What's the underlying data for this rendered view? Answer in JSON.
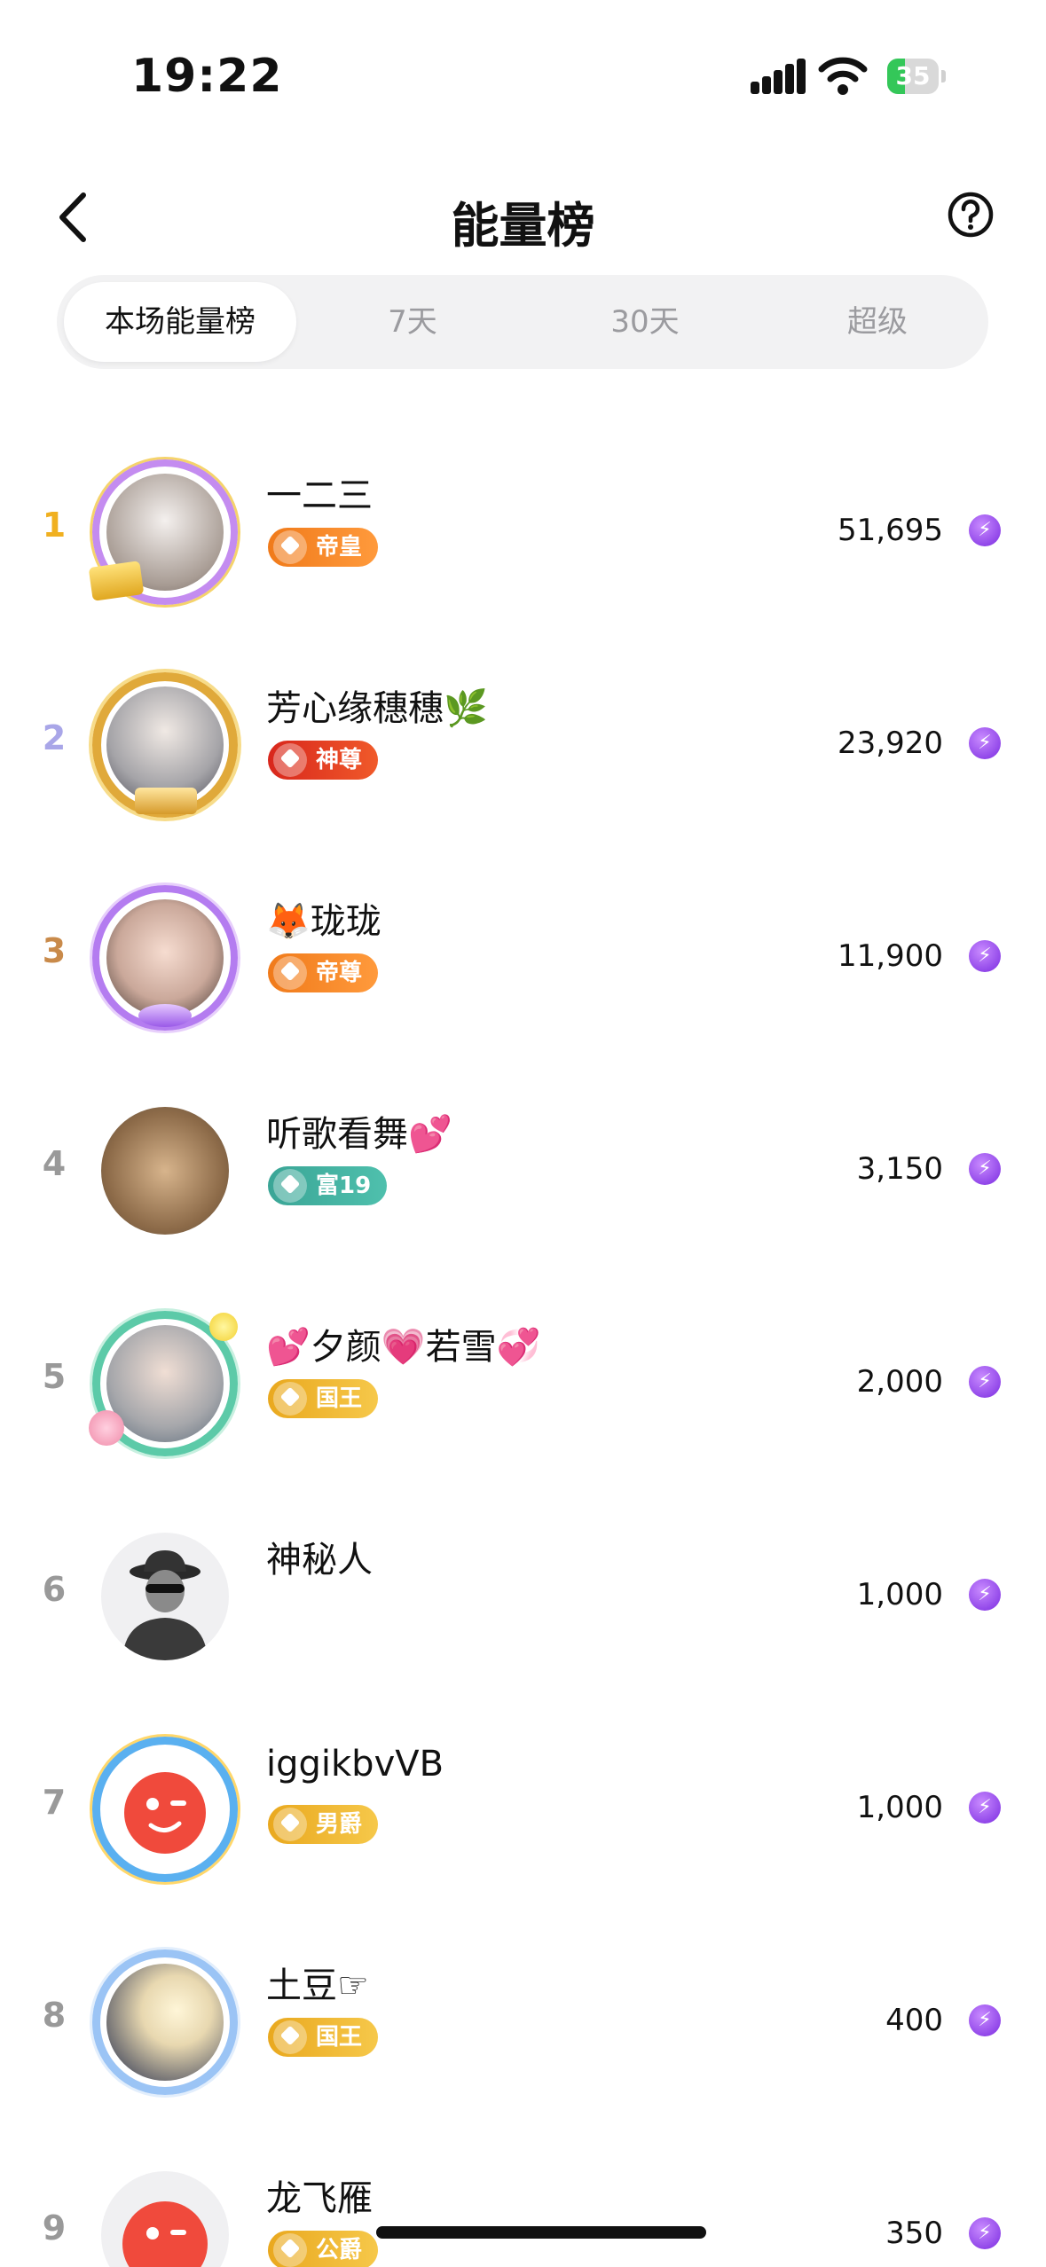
{
  "status_bar": {
    "time": "19:22",
    "battery": "35"
  },
  "header": {
    "title": "能量榜",
    "back_icon": "chevron-left-icon",
    "help_icon": "question-circle-icon"
  },
  "tabs": [
    {
      "label": "本场能量榜",
      "active": true
    },
    {
      "label": "7天",
      "active": false
    },
    {
      "label": "30天",
      "active": false
    },
    {
      "label": "超级",
      "active": false
    }
  ],
  "colors": {
    "accent_energy": "#7a2be0",
    "rank1": "#f0b020",
    "rank2": "#a9a6e8",
    "rank3": "#c98a4a",
    "rank_other": "#999999"
  },
  "rows": [
    {
      "rank": "1",
      "name": "一二三",
      "badge": "帝皇",
      "score": "51,695"
    },
    {
      "rank": "2",
      "name": "芳心缘穗穗🌿",
      "badge": "神尊",
      "score": "23,920"
    },
    {
      "rank": "3",
      "name": "🦊珑珑",
      "badge": "帝尊",
      "score": "11,900"
    },
    {
      "rank": "4",
      "name": "听歌看舞💕",
      "badge": "富19",
      "score": "3,150"
    },
    {
      "rank": "5",
      "name": "💕夕颜💗若雪💞",
      "badge": "国王",
      "score": "2,000"
    },
    {
      "rank": "6",
      "name": "神秘人",
      "badge": "",
      "score": "1,000"
    },
    {
      "rank": "7",
      "name": "iggikbvVB",
      "badge": "男爵",
      "score": "1,000"
    },
    {
      "rank": "8",
      "name": "土豆☞",
      "badge": "国王",
      "score": "400"
    },
    {
      "rank": "9",
      "name": "龙飞雁",
      "badge": "公爵",
      "score": "350"
    }
  ]
}
